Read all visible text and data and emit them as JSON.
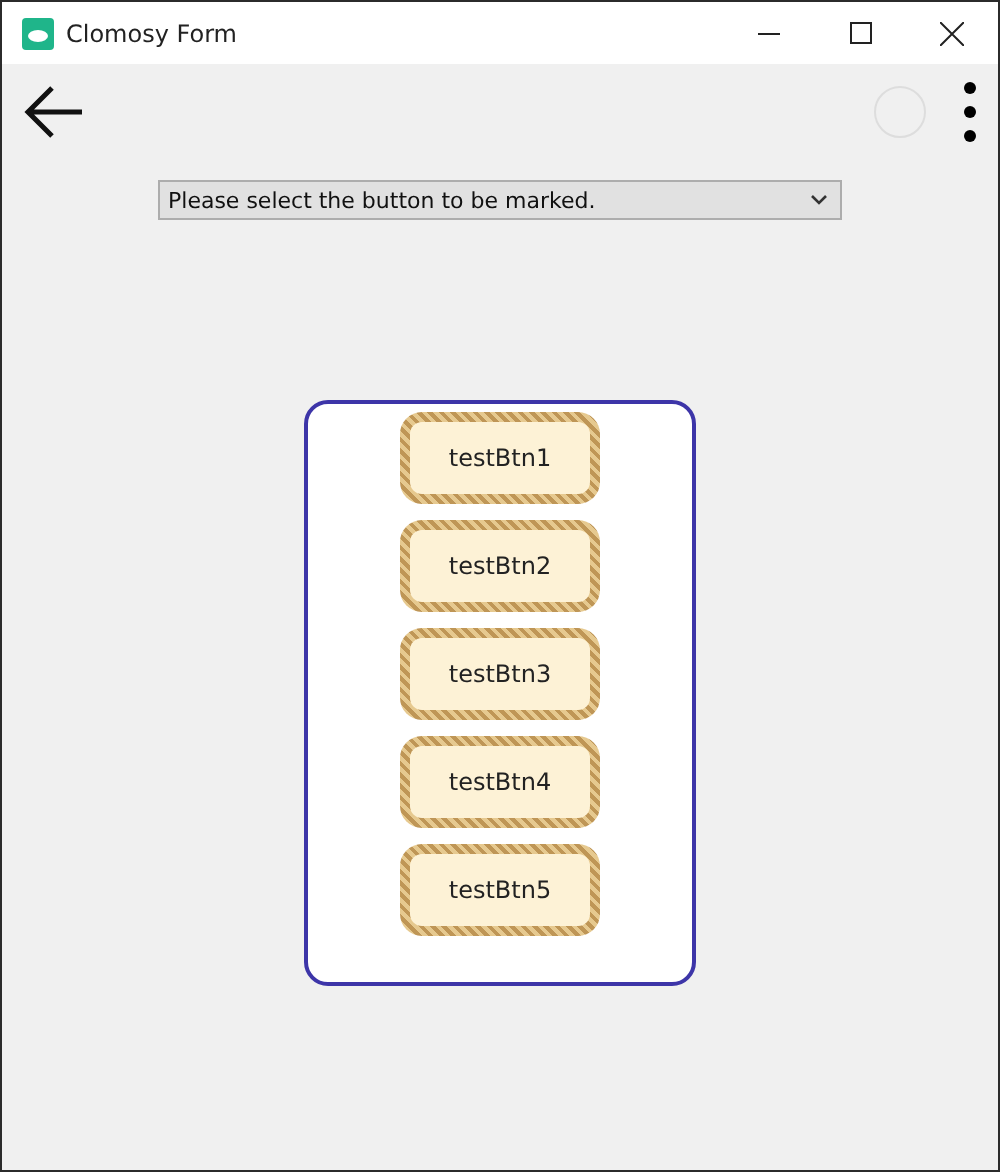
{
  "window": {
    "title": "Clomosy Form"
  },
  "dropdown": {
    "placeholder": "Please select the button to be marked."
  },
  "buttons": [
    {
      "label": "testBtn1"
    },
    {
      "label": "testBtn2"
    },
    {
      "label": "testBtn3"
    },
    {
      "label": "testBtn4"
    },
    {
      "label": "testBtn5"
    }
  ]
}
